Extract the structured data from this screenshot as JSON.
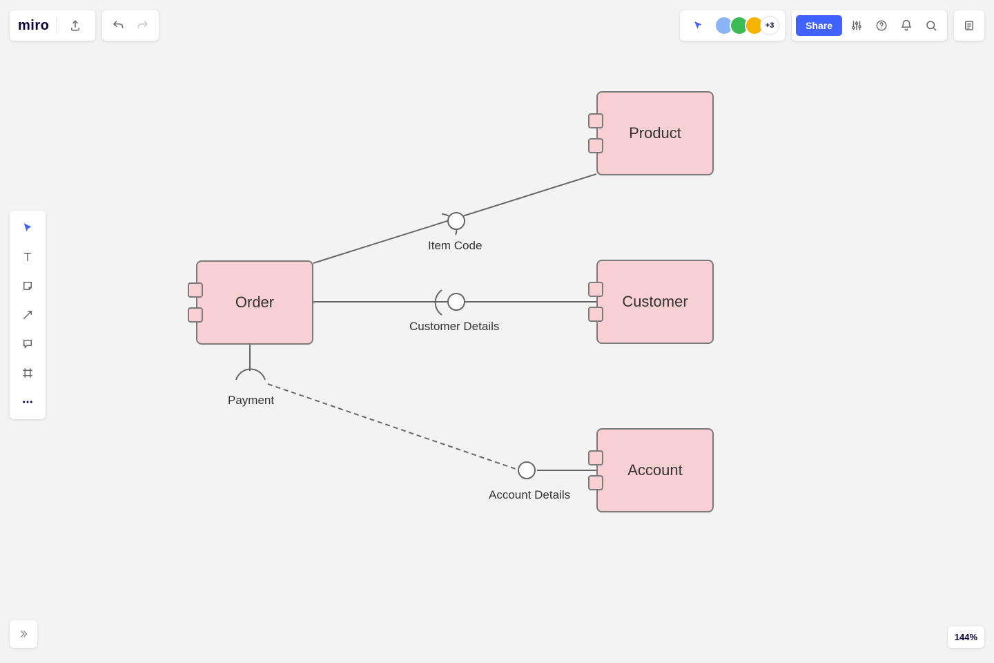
{
  "app": {
    "logo_text": "miro"
  },
  "collab": {
    "extra_count": "+3",
    "share_label": "Share"
  },
  "zoom": {
    "level": "144%"
  },
  "avatars": [
    {
      "bg": "#8ab4f8"
    },
    {
      "bg": "#3cba54"
    },
    {
      "bg": "#f4b400"
    }
  ],
  "diagram": {
    "components": {
      "order": "Order",
      "product": "Product",
      "customer": "Customer",
      "account": "Account"
    },
    "interfaces": {
      "item_code": "Item Code",
      "customer_details": "Customer Details",
      "payment": "Payment",
      "account_details": "Account Details"
    }
  },
  "chart_data": {
    "type": "diagram",
    "subtype": "uml-component",
    "components": [
      {
        "id": "order",
        "label": "Order"
      },
      {
        "id": "product",
        "label": "Product"
      },
      {
        "id": "customer",
        "label": "Customer"
      },
      {
        "id": "account",
        "label": "Account"
      }
    ],
    "interfaces": [
      {
        "id": "item_code",
        "label": "Item Code",
        "symbol": "ball-socket"
      },
      {
        "id": "customer_details",
        "label": "Customer Details",
        "symbol": "ball-socket"
      },
      {
        "id": "payment",
        "label": "Payment",
        "symbol": "socket"
      },
      {
        "id": "account_details",
        "label": "Account Details",
        "symbol": "ball"
      }
    ],
    "connectors": [
      {
        "from": "order",
        "to": "product",
        "via": "item_code",
        "style": "solid"
      },
      {
        "from": "order",
        "to": "customer",
        "via": "customer_details",
        "style": "solid"
      },
      {
        "from": "order",
        "to": "payment",
        "style": "solid"
      },
      {
        "from": "payment",
        "to": "account",
        "via": "account_details",
        "style": "dashed"
      }
    ]
  }
}
